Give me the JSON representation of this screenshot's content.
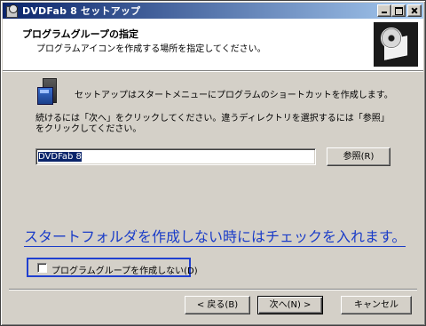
{
  "window": {
    "title": "DVDFab 8 セットアップ"
  },
  "header": {
    "title": "プログラムグループの指定",
    "subtitle": "プログラムアイコンを作成する場所を指定してください。"
  },
  "content": {
    "info_text": "セットアップはスタートメニューにプログラムのショートカットを作成します。",
    "instruction": "続けるには「次へ」をクリックしてください。違うディレクトリを選択するには「参照」をクリックしてください。",
    "group_value": "DVDFab 8",
    "browse_label": "参照(R)",
    "annotation": "スタートフォルダを作成しない時にはチェックを入れます。",
    "annotation_color": "#1a3cc8",
    "no_group_checkbox_label": "プログラムグループを作成しない(D)",
    "no_group_checked": false
  },
  "footer": {
    "back_label": "< 戻る(B)",
    "next_label": "次へ(N) >",
    "cancel_label": "キャンセル"
  },
  "colors": {
    "title_gradient_start": "#0a246a",
    "title_gradient_end": "#a6caf0",
    "dialog_bg": "#d4d0c8",
    "highlight_frame": "#2040d0"
  }
}
